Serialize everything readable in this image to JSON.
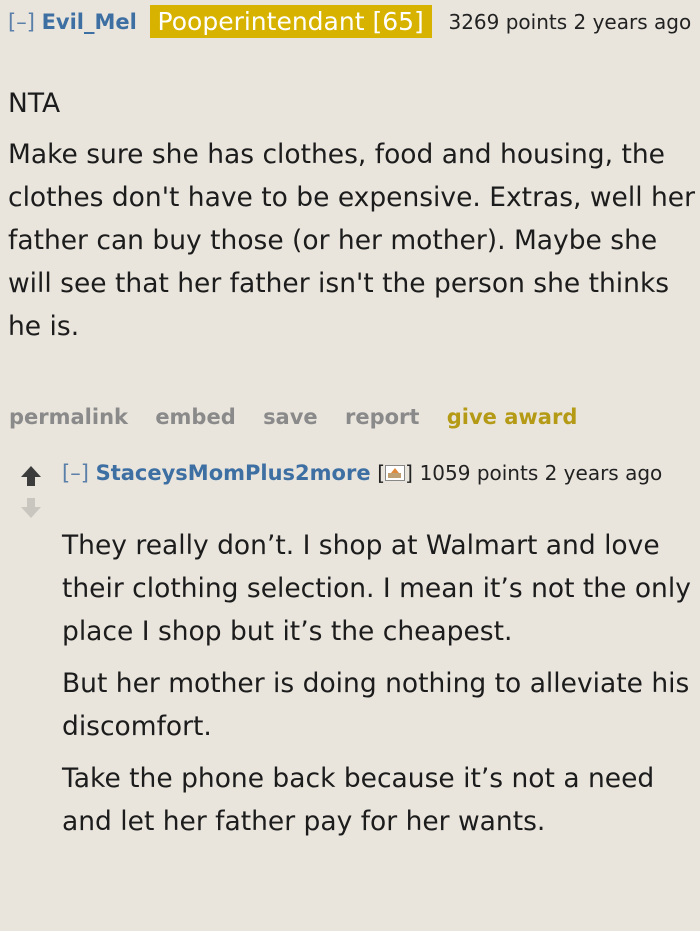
{
  "parent_comment": {
    "expand_label": "[–]",
    "author": "Evil_Mel",
    "flair": "Pooperintendant [65]",
    "meta": "3269 points 2 years ago",
    "paragraphs": [
      "NTA",
      "Make sure she has clothes, food and housing, the clothes don't have to be expensive. Extras, well her father can buy those (or her mother). Maybe she will see that her father isn't the person she thinks he is."
    ],
    "actions": {
      "permalink": "permalink",
      "embed": "embed",
      "save": "save",
      "report": "report",
      "award": "give award"
    }
  },
  "reply_comment": {
    "expand_label": "[–]",
    "author": "StaceysMomPlus2more",
    "flair_open": "[",
    "flair_close": "]",
    "flair_icon": "cake-icon",
    "meta": "1059 points 2 years ago",
    "paragraphs": [
      "They really don’t. I shop at Walmart and love their clothing selection. I mean it’s not the only place I shop but it’s the cheapest.",
      "But her mother is doing nothing to alleviate his discomfort.",
      "Take the phone back because it’s not a need and let her father pay for her wants."
    ]
  }
}
